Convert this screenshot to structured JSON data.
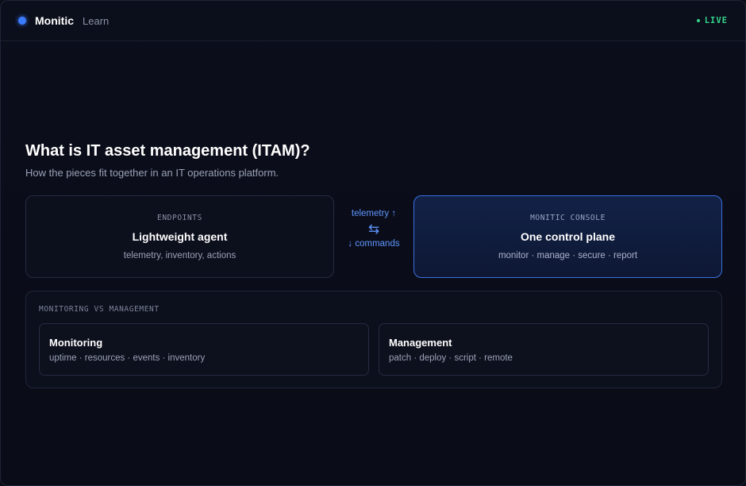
{
  "header": {
    "brand": "Monitic",
    "nav_learn": "Learn",
    "status": "LIVE"
  },
  "main": {
    "title": "What is IT asset management (ITAM)?",
    "subtitle": "How the pieces fit together in an IT operations platform."
  },
  "endpoints": {
    "kicker": "ENDPOINTS",
    "title": "Lightweight agent",
    "desc": "telemetry, inventory, actions"
  },
  "flow": {
    "up": "telemetry ↑",
    "icon": "⇆",
    "down": "↓ commands"
  },
  "console": {
    "kicker": "MONITIC CONSOLE",
    "title": "One control plane",
    "desc": "monitor · manage · secure · report"
  },
  "comparison": {
    "kicker": "MONITORING VS MANAGEMENT",
    "monitoring": {
      "title": "Monitoring",
      "desc": "uptime · resources · events · inventory"
    },
    "management": {
      "title": "Management",
      "desc": "patch · deploy · script · remote"
    }
  },
  "colors": {
    "accent": "#3b7bff",
    "live": "#34d48a",
    "background": "#0b0d18"
  },
  "icons": {
    "brand": "brand-dot-icon",
    "live": "status-dot-icon",
    "flow": "bidirectional-arrows-icon"
  }
}
